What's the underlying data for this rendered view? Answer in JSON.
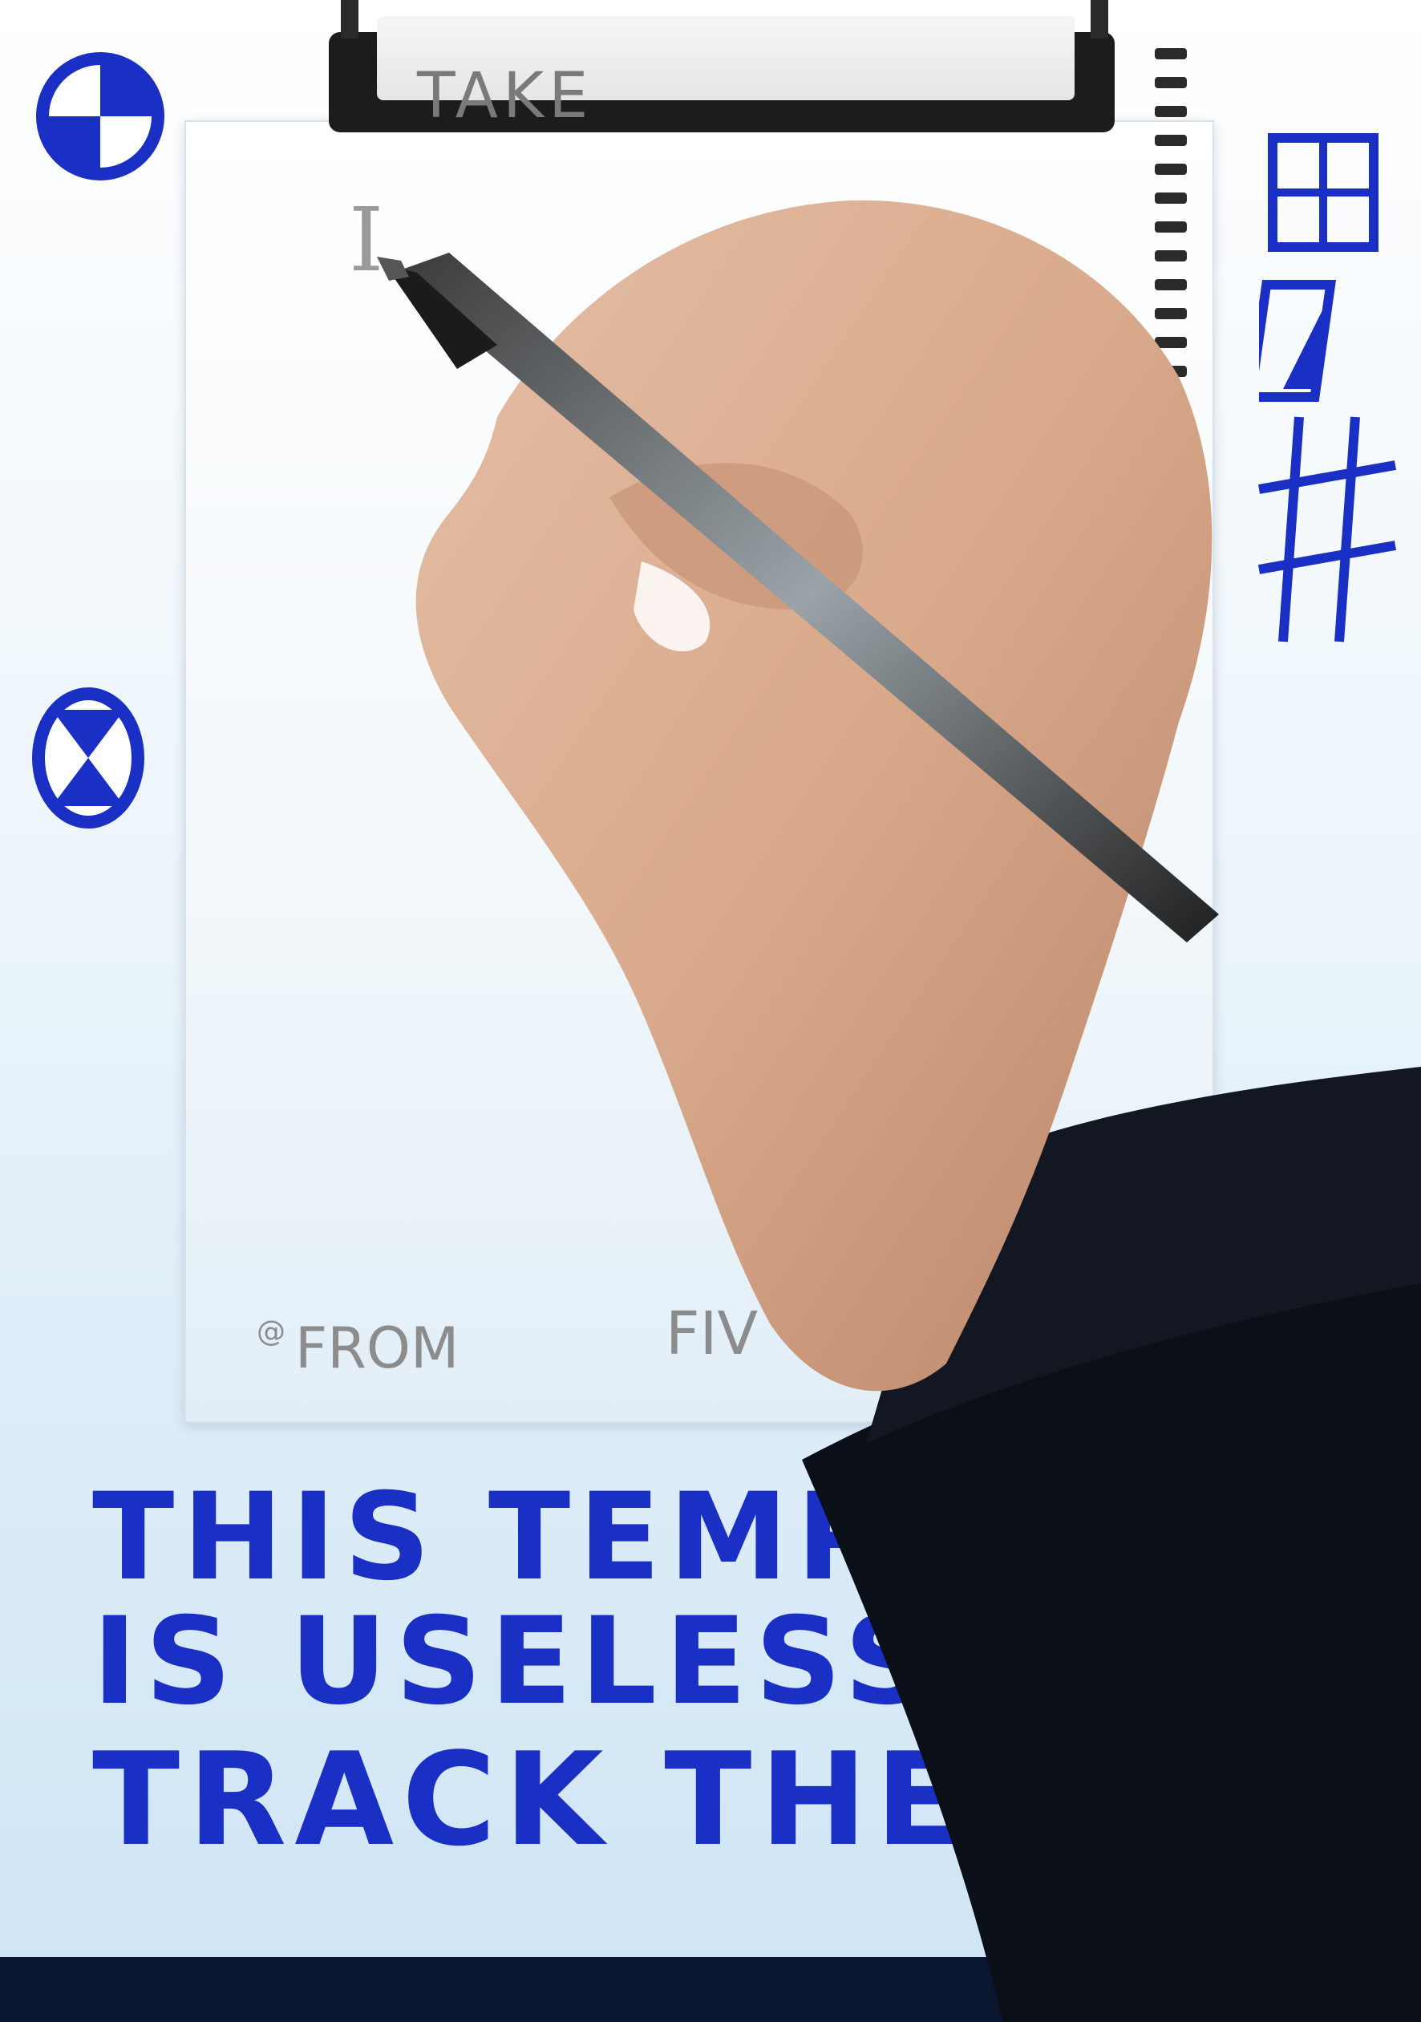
{
  "page": {
    "title": "TAKE",
    "cursor_glyph": "I",
    "footer_left": "FROM",
    "footer_right": "FIV",
    "footer_mark": "@"
  },
  "handwriting": {
    "line1": "THIS TEMPL",
    "line2": "IS USELESS",
    "line3": "TRACK THE NOTE"
  },
  "icons": {
    "top_left": "quartered-circle-icon",
    "mid_left": "hourglass-circle-icon",
    "grid": "grid-2x2-icon",
    "edit": "edit-box-icon",
    "hash": "hash-icon"
  },
  "colors": {
    "ink_blue": "#1a2fc4",
    "page_text": "#8c8c8c",
    "background_blue": "#dcecf8"
  }
}
